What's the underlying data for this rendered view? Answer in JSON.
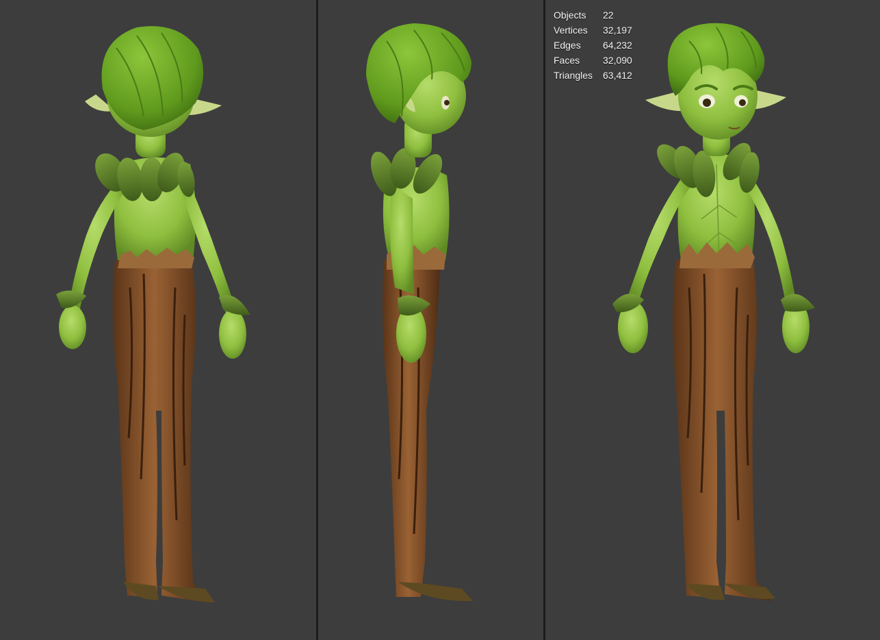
{
  "viewports": [
    {
      "view": "back-three-quarter"
    },
    {
      "view": "side"
    },
    {
      "view": "front-three-quarter"
    }
  ],
  "stats": {
    "rows": [
      {
        "label": "Objects",
        "value": "22"
      },
      {
        "label": "Vertices",
        "value": "32,197"
      },
      {
        "label": "Edges",
        "value": "64,232"
      },
      {
        "label": "Faces",
        "value": "32,090"
      },
      {
        "label": "Triangles",
        "value": "63,412"
      }
    ]
  },
  "colors": {
    "viewport_bg": "#3d3d3d",
    "separator": "#1c1c1c",
    "skin": "#8fbf3f",
    "hair": "#6aa321",
    "bark": "#7a4a24",
    "leaf": "#5e7f2a",
    "stats_text": "#f2f2f2"
  }
}
